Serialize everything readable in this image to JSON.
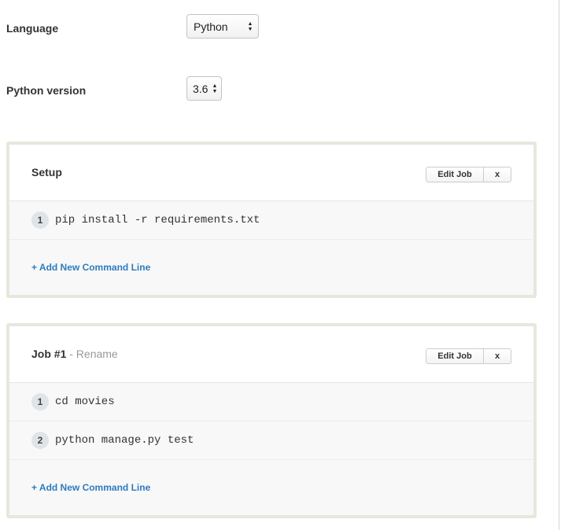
{
  "settings": {
    "language_label": "Language",
    "language_value": "Python",
    "python_version_label": "Python version",
    "python_version_value": "3.6"
  },
  "setup": {
    "title": "Setup",
    "edit_label": "Edit Job",
    "close_label": "x",
    "commands": [
      {
        "num": "1",
        "text": "pip install -r requirements.txt"
      }
    ],
    "add_label": "+ Add New Command Line"
  },
  "job1": {
    "title": "Job #1",
    "rename_label": "- Rename",
    "edit_label": "Edit Job",
    "close_label": "x",
    "commands": [
      {
        "num": "1",
        "text": "cd movies"
      },
      {
        "num": "2",
        "text": "python manage.py test"
      }
    ],
    "add_label": "+ Add New Command Line"
  },
  "icons": {
    "select_arrows": "up-down-arrows-icon"
  }
}
